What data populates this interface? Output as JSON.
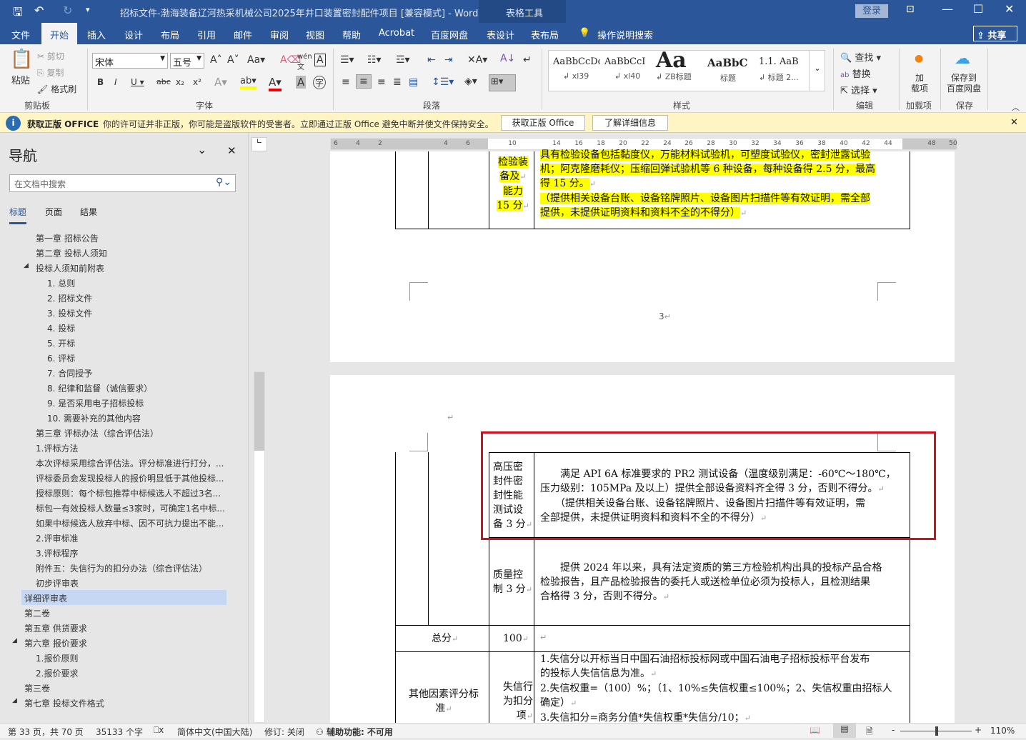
{
  "title": "招标文件-渤海装备辽河热采机械公司2025年井口装置密封配件项目 [兼容模式]  -  Word",
  "context_tab": "表格工具",
  "login": "登录",
  "tabs": [
    "文件",
    "开始",
    "插入",
    "设计",
    "布局",
    "引用",
    "邮件",
    "审阅",
    "视图",
    "帮助",
    "Acrobat",
    "百度网盘",
    "表设计",
    "表布局"
  ],
  "tell_me": "操作说明搜索",
  "share": "共享",
  "ribbon": {
    "paste": "粘贴",
    "cut": "剪切",
    "copy": "复制",
    "format_painter": "格式刷",
    "clipboard": "剪贴板",
    "font_name": "宋体",
    "font_size": "五号",
    "font": "字体",
    "paragraph": "段落",
    "styles": [
      {
        "preview": "AaBbCcDc",
        "name": "xl39"
      },
      {
        "preview": "AaBbCcI",
        "name": "xl40"
      },
      {
        "preview": "Aa",
        "name": "ZB标题"
      },
      {
        "preview": "AaBbC",
        "name": "标题"
      },
      {
        "preview": "1.1. AaB",
        "name": "标题 2..."
      }
    ],
    "styles_label": "样式",
    "find": "查找",
    "replace": "替换",
    "select": "选择",
    "editing": "编辑",
    "addin": "加\n载项",
    "addins": "加载项",
    "save_baidu": "保存到\n百度网盘",
    "save": "保存"
  },
  "warning": {
    "title": "获取正版 OFFICE",
    "message": "你的许可证并非正版，你可能是盗版软件的受害者。立即通过正版 Office 避免中断并使文件保持安全。",
    "btn1": "获取正版 Office",
    "btn2": "了解详细信息"
  },
  "nav": {
    "title": "导航",
    "search_placeholder": "在文档中搜索",
    "tabs": [
      "标题",
      "页面",
      "结果"
    ],
    "items": [
      {
        "t": "第一章  招标公告",
        "l": 1
      },
      {
        "t": "第二章  投标人须知",
        "l": 1
      },
      {
        "t": "投标人须知前附表",
        "l": 1,
        "exp": true
      },
      {
        "t": "1. 总则",
        "l": 2
      },
      {
        "t": "2. 招标文件",
        "l": 2
      },
      {
        "t": "3. 投标文件",
        "l": 2
      },
      {
        "t": "4. 投标",
        "l": 2
      },
      {
        "t": "5. 开标",
        "l": 2
      },
      {
        "t": "6. 评标",
        "l": 2
      },
      {
        "t": "7. 合同授予",
        "l": 2
      },
      {
        "t": "8. 纪律和监督（诚信要求）",
        "l": 2
      },
      {
        "t": "9. 是否采用电子招标投标",
        "l": 2
      },
      {
        "t": "10. 需要补充的其他内容",
        "l": 2
      },
      {
        "t": "第三章  评标办法（综合评估法）",
        "l": 1
      },
      {
        "t": "1.评标方法",
        "l": 1
      },
      {
        "t": "本次评标采用综合评估法。评分标准进行打分，...",
        "l": 1
      },
      {
        "t": "评标委员会发现投标人的报价明显低于其他投标...",
        "l": 1
      },
      {
        "t": "授标原则：每个标包推荐中标候选人不超过3名...",
        "l": 1
      },
      {
        "t": "标包一有效投标人数量≤3家时，可确定1名中标...",
        "l": 1
      },
      {
        "t": "如果中标候选人放弃中标、因不可抗力提出不能...",
        "l": 1
      },
      {
        "t": "2.评审标准",
        "l": 1
      },
      {
        "t": "3.评标程序",
        "l": 1
      },
      {
        "t": "附件五：失信行为的扣分办法（综合评估法）",
        "l": 1
      },
      {
        "t": "初步评审表",
        "l": 1
      },
      {
        "t": "详细评审表",
        "l": 0,
        "sel": true
      },
      {
        "t": "第二卷",
        "l": 0
      },
      {
        "t": "第五章  供货要求",
        "l": 0
      },
      {
        "t": "第六章  报价要求",
        "l": 0,
        "exp": true
      },
      {
        "t": "1.报价原则",
        "l": 1
      },
      {
        "t": "2.报价要求",
        "l": 1
      },
      {
        "t": "第三卷",
        "l": 0
      },
      {
        "t": "第七章  投标文件格式",
        "l": 0,
        "exp": true
      }
    ]
  },
  "ruler": [
    "6",
    "4",
    "2",
    "4",
    "6",
    "10",
    "14",
    "16",
    "18",
    "20",
    "22",
    "24",
    "26",
    "28",
    "30",
    "32",
    "34",
    "36",
    "38",
    "40",
    "42",
    "44",
    "48",
    "50"
  ],
  "doc": {
    "p1_label": [
      "检验装",
      "备及",
      "能力",
      "15 分"
    ],
    "p1_lines": [
      "具有检验设备包括黏度仪，万能材料试验机，可塑度试验仪，密封泄露试验",
      "机；阿克隆磨耗仪；压缩回弹试验机等 6 种设备，每种设备得 2.5 分，最高",
      "得 15 分。",
      "（提供相关设备台账、设备铭牌照片、设备图片扫描件等有效证明，需全部",
      "提供，未提供证明资料和资料不全的不得分）"
    ],
    "page_num": "3",
    "r1_label": [
      "高压密",
      "封件密",
      "封性能",
      "测试设",
      "备 3 分"
    ],
    "r1_lines": [
      "　　满足 API 6A 标准要求的 PR2 测试设备（温度级别满足：-60℃～180℃，",
      "压力级别：105MPa 及以上）提供全部设备资料齐全得 3 分，否则不得分。",
      "　　（提供相关设备台账、设备铭牌照片、设备图片扫描件等有效证明，需",
      "全部提供，未提供证明资料和资料不全的不得分）"
    ],
    "r2_label": [
      "质量控",
      "制 3 分"
    ],
    "r2_lines": [
      "　　提供 2024 年以来，具有法定资质的第三方检验机构出具的投标产品合格",
      "检验报告，且产品检验报告的委托人或送检单位必须为投标人，且检测结果",
      "合格得 3 分，否则不得分。"
    ],
    "total_label": "总分",
    "total_value": "100",
    "other_label": [
      "其他因素评分标",
      "准"
    ],
    "other_sub": [
      "失信行",
      "为扣分",
      "项"
    ],
    "other_lines": [
      "1.失信分以开标当日中国石油招标投标网或中国石油电子招标投标平台发布",
      "的投标人失信信息为准。",
      "2.失信权重=（100）%；（1、10%≤失信权重≤100%；2、失信权重由招标人",
      "确定）",
      "3.失信扣分=商务分值*失信权重*失信分/10；"
    ]
  },
  "status": {
    "page": "第 33 页，共 70 页",
    "words": "35133 个字",
    "lang": "简体中文(中国大陆)",
    "track": "修订: 关闭",
    "access": "辅助功能: 不可用",
    "zoom": "110%"
  },
  "colors": {
    "brand": "#2b579a",
    "highlight": "#ffff00",
    "annotation": "#d0101c"
  }
}
